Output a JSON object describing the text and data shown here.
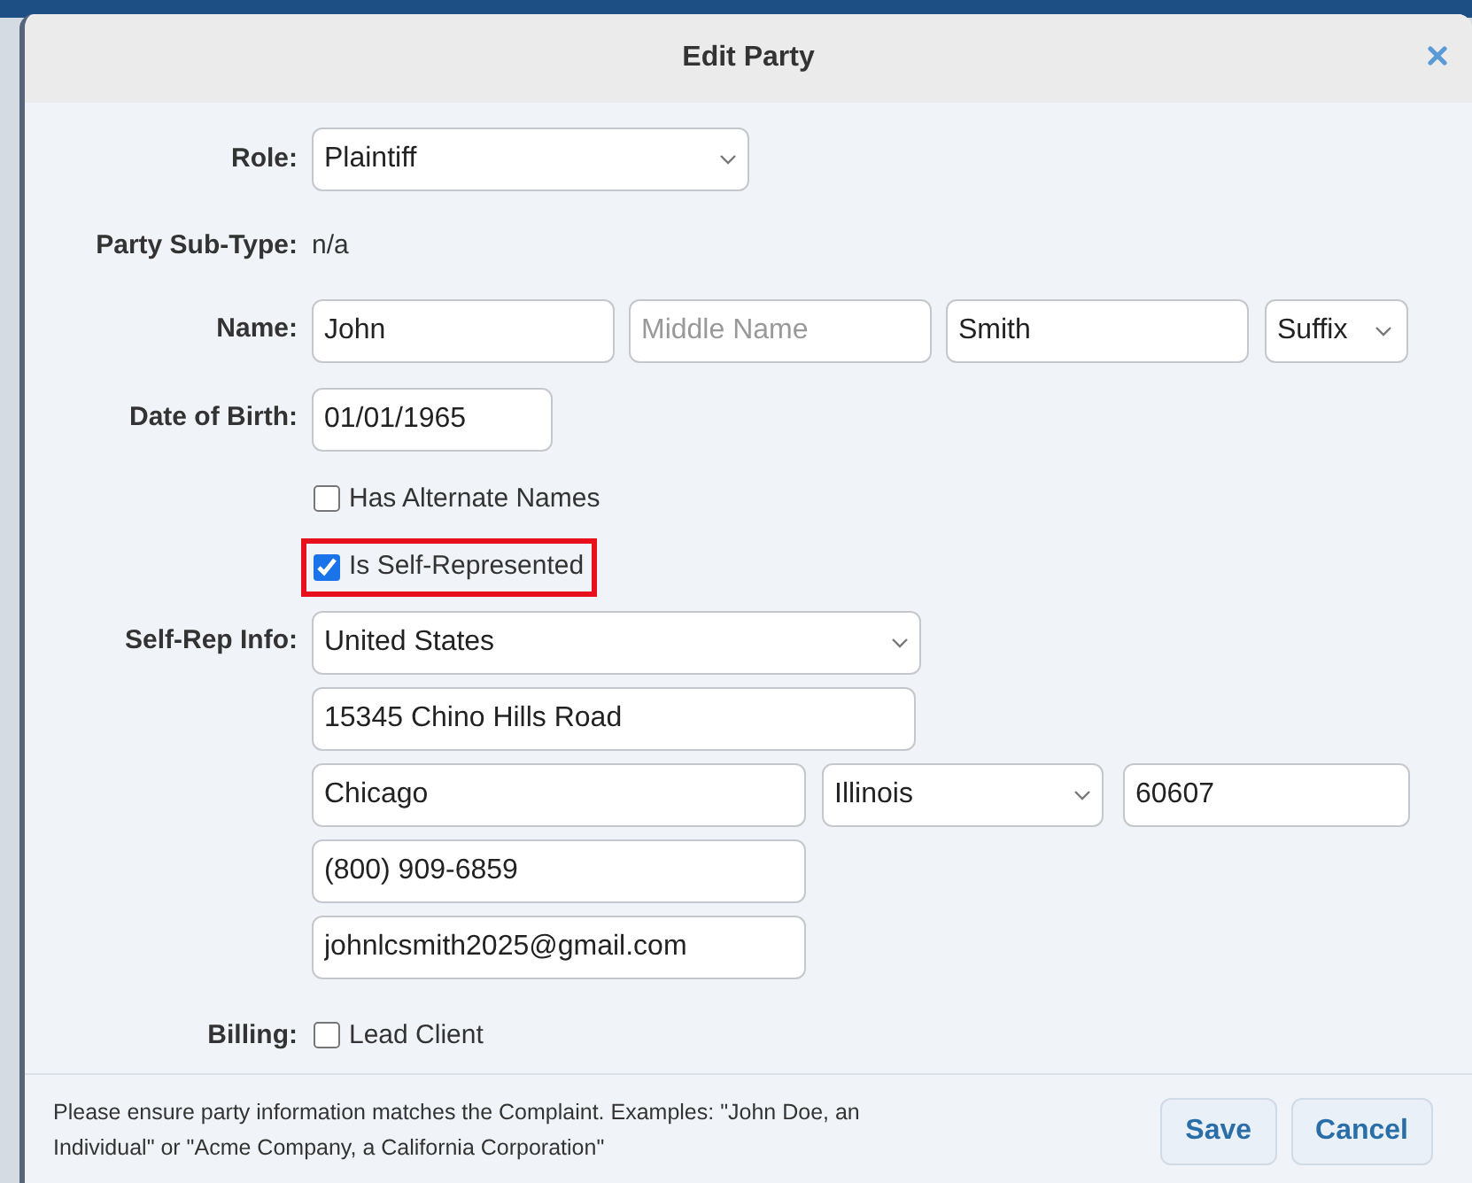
{
  "dialog": {
    "title": "Edit Party"
  },
  "role": {
    "label": "Role:",
    "value": "Plaintiff"
  },
  "sub_type": {
    "label": "Party Sub-Type:",
    "value": "n/a"
  },
  "name": {
    "label": "Name:",
    "first": "John",
    "middle_placeholder": "Middle Name",
    "last": "Smith",
    "suffix": "Suffix"
  },
  "date_of_birth": {
    "label": "Date of Birth:",
    "value": "01/01/1965"
  },
  "options": [
    {
      "label": "Has Alternate Names",
      "checked": false,
      "highlighted": false
    },
    {
      "label": "Is Self-Represented",
      "checked": true,
      "highlighted": true
    }
  ],
  "self_rep": {
    "label": "Self-Rep Info:",
    "country": "United States",
    "street": "15345 Chino Hills Road",
    "city": "Chicago",
    "state": "Illinois",
    "zip": "60607",
    "phone": "(800) 909-6859",
    "email": "johnlcsmith2025@gmail.com"
  },
  "billing": {
    "label": "Billing:",
    "option": {
      "label": "Lead Client",
      "checked": false
    }
  },
  "footer": {
    "note": "Please ensure party information matches the Complaint. Examples: \"John Doe, an Individual\" or \"Acme Company, a California Corporation\"",
    "buttons": [
      "Save",
      "Cancel"
    ]
  }
}
